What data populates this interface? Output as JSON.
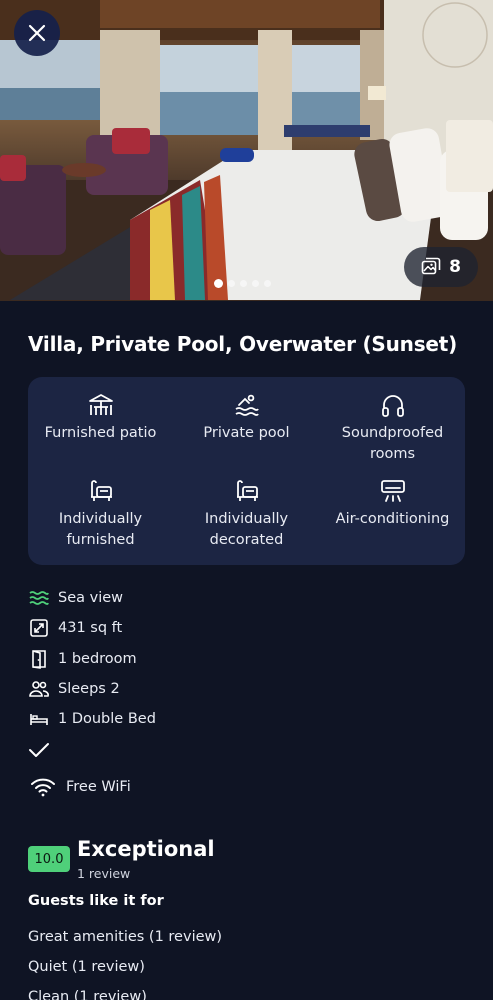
{
  "gallery": {
    "photo_count": "8",
    "total_dots": 5,
    "active_dot": 1
  },
  "room": {
    "title": "Villa, Private Pool, Overwater (Sunset)"
  },
  "amenities": [
    {
      "icon": "patio-icon",
      "label": "Furnished patio"
    },
    {
      "icon": "pool-icon",
      "label": "Private pool"
    },
    {
      "icon": "headphones-icon",
      "label": "Soundproofed rooms"
    },
    {
      "icon": "armchair-icon",
      "label": "Individually furnished"
    },
    {
      "icon": "armchair-icon",
      "label": "Individually decorated"
    },
    {
      "icon": "air-conditioner-icon",
      "label": "Air-conditioning"
    }
  ],
  "features": [
    {
      "icon": "waves-icon",
      "label": "Sea view",
      "color": "#4fd07a"
    },
    {
      "icon": "expand-icon",
      "label": "431 sq ft"
    },
    {
      "icon": "door-icon",
      "label": "1 bedroom"
    },
    {
      "icon": "people-icon",
      "label": "Sleeps 2"
    },
    {
      "icon": "bed-icon",
      "label": "1 Double Bed"
    },
    {
      "icon": "checkmark-icon",
      "label": ""
    },
    {
      "icon": "wifi-icon",
      "label": "Free WiFi"
    }
  ],
  "reviews": {
    "score": "10.0",
    "score_color": "#4fd07a",
    "rating_word": "Exceptional",
    "count": "1 review",
    "likes_heading": "Guests like it for",
    "likes": [
      "Great amenities (1 review)",
      "Quiet (1 review)",
      "Clean (1 review)"
    ]
  },
  "colors": {
    "background": "#0f1424",
    "card": "#1c2543",
    "close_button": "#15214b",
    "accent_green": "#4fd07a"
  }
}
